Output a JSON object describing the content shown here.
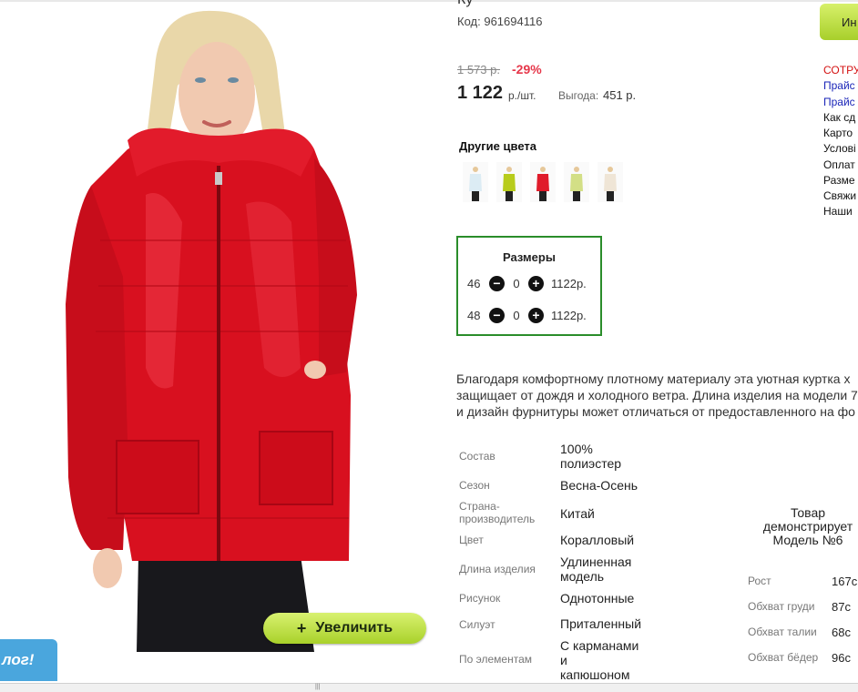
{
  "product": {
    "title_cut": "Ку",
    "code_label": "Код:",
    "code": "961694116",
    "old_price": "1 573 р.",
    "discount": "-29%",
    "price": "1 122",
    "price_unit": "р./шт.",
    "savings_label": "Выгода:",
    "savings_value": "451 р.",
    "zoom_button": "Увеличить",
    "zoom_plus": "+"
  },
  "other_colors": {
    "title": "Другие цвета",
    "swatches": [
      {
        "name": "white-blue jacket",
        "color": "#dcecf4"
      },
      {
        "name": "lime jacket",
        "color": "#b8cc1c"
      },
      {
        "name": "red jacket",
        "color": "#e01b2a"
      },
      {
        "name": "light lime jacket",
        "color": "#d3df86"
      },
      {
        "name": "cream jacket",
        "color": "#efe5d6"
      }
    ]
  },
  "sizes": {
    "title": "Размеры",
    "rows": [
      {
        "size": "46",
        "minus": "−",
        "qty": "0",
        "plus": "+",
        "price": "1122р."
      },
      {
        "size": "48",
        "minus": "−",
        "qty": "0",
        "plus": "+",
        "price": "1122р."
      }
    ]
  },
  "description": {
    "lines": [
      "Благодаря комфортному плотному материалу эта уютная куртка х",
      "защищает от дождя и холодного ветра. Длина изделия на модели 7",
      "и дизайн фурнитуры может отличаться от предоставленного на фо"
    ]
  },
  "specs": [
    {
      "label": "Состав",
      "value": "100%\nполиэстер"
    },
    {
      "label": "Сезон",
      "value": "Весна-Осень"
    },
    {
      "label": "Страна-\nпроизводитель",
      "value": "Китай"
    },
    {
      "label": "Цвет",
      "value": "Коралловый"
    },
    {
      "label": "Длина изделия",
      "value": "Удлиненная\nмодель"
    },
    {
      "label": "Рисунок",
      "value": "Однотонные"
    },
    {
      "label": "Силуэт",
      "value": "Приталенный"
    },
    {
      "label": "По элементам",
      "value": "С карманами\nи\nкапюшоном"
    }
  ],
  "model": {
    "title": "Товар демонстрирует Модель №6",
    "rows": [
      {
        "label": "Рост",
        "value": "167с"
      },
      {
        "label": "Обхват груди",
        "value": "87с"
      },
      {
        "label": "Обхват талии",
        "value": "68с"
      },
      {
        "label": "Обхват бёдер",
        "value": "96с"
      }
    ]
  },
  "sidebar": {
    "button": "Ин",
    "links": [
      {
        "text": "СОТРУ",
        "color": "#d41212"
      },
      {
        "text": "Прайс",
        "color": "#1a25b8"
      },
      {
        "text": "Прайс",
        "color": "#1a25b8"
      },
      {
        "text": "Как сд",
        "color": "#111111"
      },
      {
        "text": "Карто",
        "color": "#111111"
      },
      {
        "text": "Услові",
        "color": "#111111"
      },
      {
        "text": "Оплат",
        "color": "#111111"
      },
      {
        "text": "Разме",
        "color": "#111111"
      },
      {
        "text": "Свяжи",
        "color": "#111111"
      },
      {
        "text": "Наши",
        "color": "#111111"
      }
    ]
  },
  "catalog_tab": "лог!",
  "colors": {
    "accent_green": "#2a8d2a",
    "discount_red": "#e6374a",
    "jacket_red": "#e01b2a",
    "button_lime": "#b6da3c",
    "tab_blue": "#4aa6dd"
  }
}
